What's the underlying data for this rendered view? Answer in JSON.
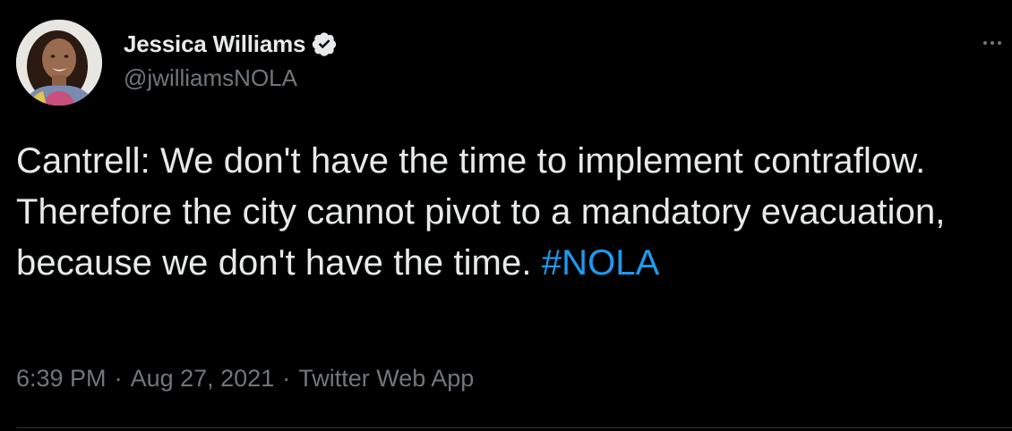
{
  "user": {
    "display_name": "Jessica Williams",
    "handle": "@jwilliamsNOLA",
    "verified": true
  },
  "tweet": {
    "text_plain": "Cantrell: We don't have the time to implement contraflow. Therefore the city cannot pivot to a mandatory evacuation, because we don't have the time.",
    "hashtag": "#NOLA"
  },
  "meta": {
    "time": "6:39 PM",
    "separator": "·",
    "date": "Aug 27, 2021",
    "source": "Twitter Web App"
  },
  "colors": {
    "background": "#000000",
    "text": "#e7e9ea",
    "muted": "#71767b",
    "link": "#1d9bf0",
    "divider": "#2f3336"
  },
  "icons": {
    "verified": "verified-badge-icon",
    "more": "more-options-icon"
  }
}
